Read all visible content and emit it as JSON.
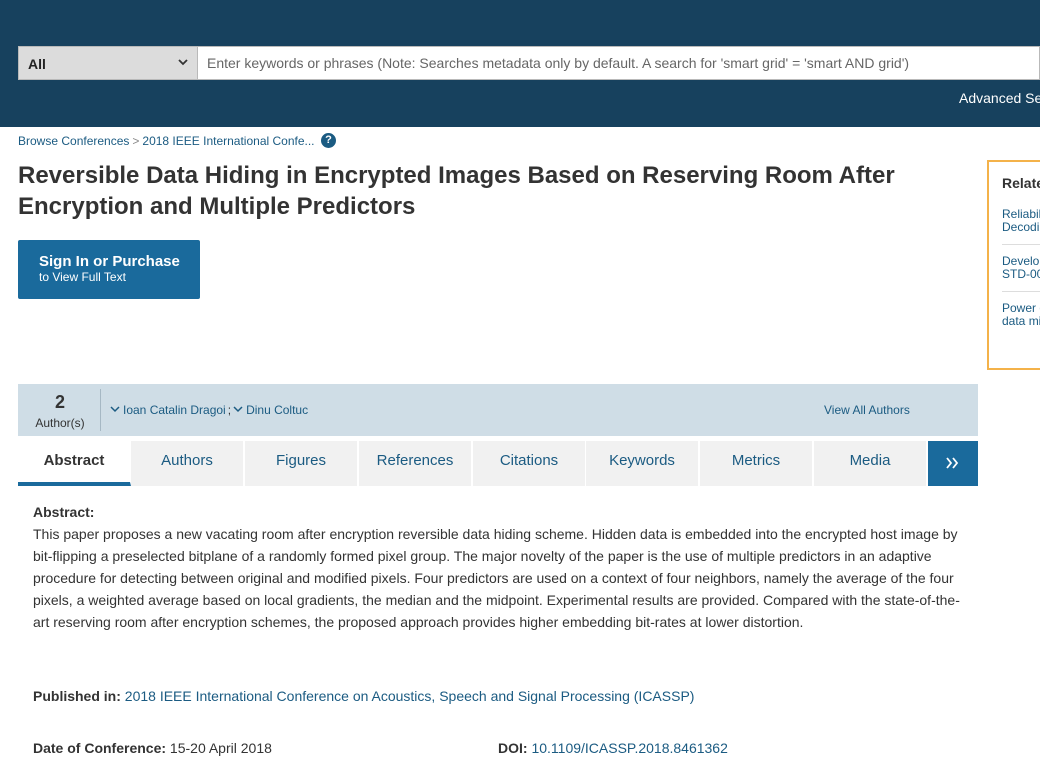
{
  "search": {
    "scope_selected": "All",
    "placeholder": "Enter keywords or phrases (Note: Searches metadata only by default. A search for 'smart grid' = 'smart AND grid')",
    "advanced_label": "Advanced Se"
  },
  "breadcrumb": {
    "items": [
      "Browse Conferences",
      "2018 IEEE International Confe..."
    ],
    "separator": ">",
    "help_glyph": "?"
  },
  "article": {
    "title": "Reversible Data Hiding in Encrypted Images Based on Reserving Room After Encryption and Multiple Predictors"
  },
  "signin": {
    "line1": "Sign In or Purchase",
    "line2": "to View Full Text"
  },
  "related": {
    "title": "Relate",
    "items": [
      {
        "line1": "Reliabil",
        "line2": "Decodin"
      },
      {
        "line1": "Develop",
        "line2": "STD-00"
      },
      {
        "line1": "Power o",
        "line2": "data mi"
      }
    ]
  },
  "authors_bar": {
    "count": "2",
    "count_label": "Author(s)",
    "authors": [
      "Ioan Catalin Dragoi",
      "Dinu Coltuc"
    ],
    "separator": ";",
    "view_all_label": "View All Authors"
  },
  "tabs": [
    "Abstract",
    "Authors",
    "Figures",
    "References",
    "Citations",
    "Keywords",
    "Metrics",
    "Media"
  ],
  "active_tab": "Abstract",
  "more_tabs_glyph": "»",
  "abstract": {
    "heading": "Abstract:",
    "text": "This paper proposes a new vacating room after encryption reversible data hiding scheme. Hidden data is embedded into the encrypted host image by bit-flipping a preselected bitplane of a randomly formed pixel group. The major novelty of the paper is the use of multiple predictors in an adaptive procedure for detecting between original and modified pixels. Four predictors are used on a context of four neighbors, namely the average of the four pixels, a weighted average based on local gradients, the median and the midpoint. Experimental results are provided. Compared with the state-of-the-art reserving room after encryption schemes, the proposed approach provides higher embedding bit-rates at lower distortion."
  },
  "meta": {
    "published_label": "Published in:",
    "published_value": "2018 IEEE International Conference on Acoustics, Speech and Signal Processing (ICASSP)",
    "date_label": "Date of Conference:",
    "date_value": "15-20 April 2018",
    "doi_label": "DOI:",
    "doi_value": "10.1109/ICASSP.2018.8461362"
  },
  "colors": {
    "header_bg": "#17415e",
    "accent_blue": "#1a6a9c",
    "link_blue": "#1b5b82",
    "related_border": "#f4b24a",
    "authors_bar_bg": "#cfdde6"
  }
}
